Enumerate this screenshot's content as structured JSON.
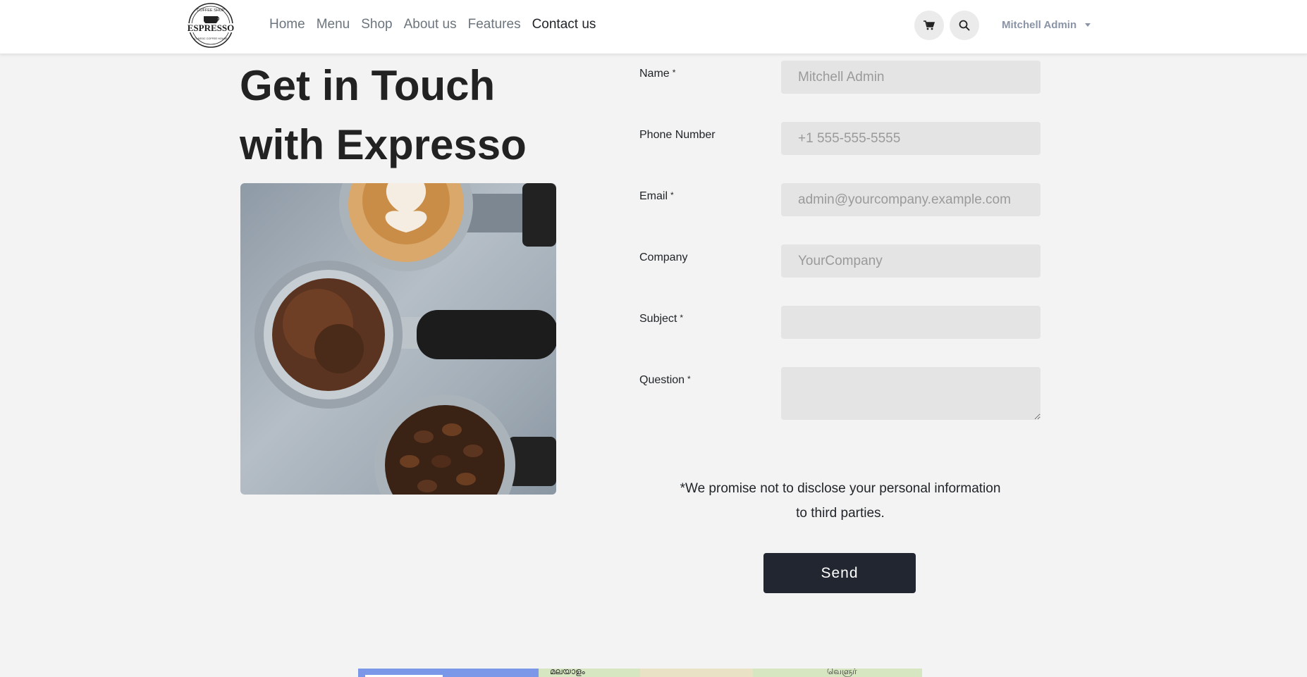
{
  "header": {
    "logo": {
      "top_text": "COFFEE SHOP",
      "brand": "ESPRESSO",
      "bottom_text": "CLASSIC COFFEE HOUSE"
    },
    "nav": [
      {
        "label": "Home"
      },
      {
        "label": "Menu"
      },
      {
        "label": "Shop"
      },
      {
        "label": "About us"
      },
      {
        "label": "Features"
      },
      {
        "label": "Contact us",
        "active": true
      }
    ],
    "cart_icon": "cart-icon",
    "search_icon": "search-icon",
    "user": "Mitchell Admin"
  },
  "main": {
    "title_line1": "Get in Touch",
    "title_line2": "with Expresso",
    "photo": "coffee-portafilters-photo"
  },
  "form": {
    "name": {
      "label": "Name",
      "required": "*",
      "placeholder": "Mitchell Admin"
    },
    "phone": {
      "label": "Phone Number",
      "placeholder": "+1 555-555-5555"
    },
    "email": {
      "label": "Email",
      "required": "*",
      "placeholder": "admin@yourcompany.example.com"
    },
    "company": {
      "label": "Company",
      "placeholder": "YourCompany"
    },
    "subject": {
      "label": "Subject",
      "required": "*",
      "placeholder": ""
    },
    "question": {
      "label": "Question",
      "required": "*",
      "placeholder": ""
    },
    "privacy": "*We promise not to disclose your personal information to third parties.",
    "send": "Send"
  },
  "map": {
    "label_left": "മലയാളം",
    "label_right": "வெளுர்"
  },
  "colors": {
    "page_bg": "#f3f3f3",
    "button_bg": "#212631",
    "input_bg": "#e4e4e4",
    "nav_muted": "#6c757d"
  }
}
